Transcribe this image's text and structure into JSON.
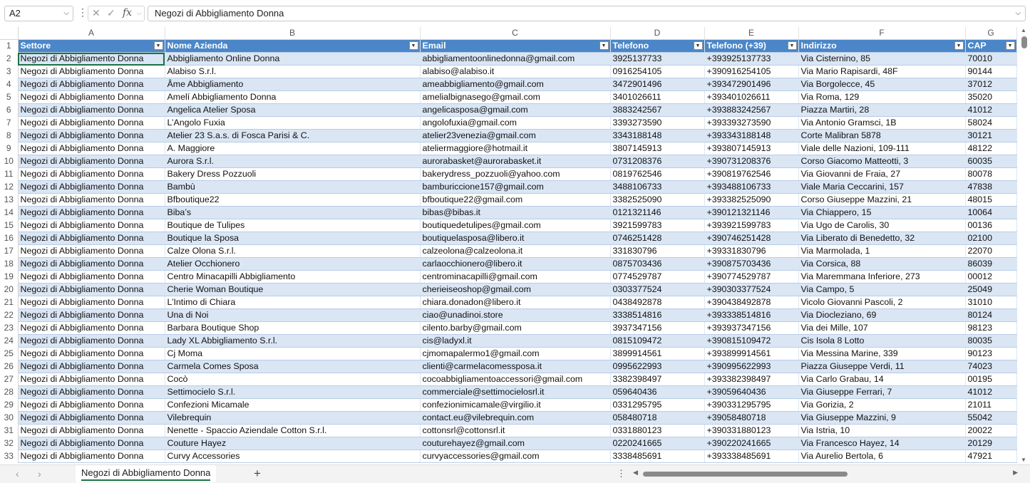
{
  "formula_bar": {
    "name_box": "A2",
    "formula": "Negozi di Abbigliamento Donna"
  },
  "column_letters": [
    "A",
    "B",
    "C",
    "D",
    "E",
    "F",
    "G"
  ],
  "headers": [
    "Settore",
    "Nome Azienda",
    "Email",
    "Telefono",
    "Telefono (+39)",
    "Indirizzo",
    "CAP"
  ],
  "rows": [
    [
      "Negozi di Abbigliamento Donna",
      "Abbigliamento Online Donna",
      "abbigliamentoonlinedonna@gmail.com",
      "3925137733",
      "+393925137733",
      "Via Cisternino, 85",
      "70010"
    ],
    [
      "Negozi di Abbigliamento Donna",
      "Alabiso S.r.l.",
      "alabiso@alabiso.it",
      "0916254105",
      "+390916254105",
      "Via Mario Rapisardi, 48F",
      "90144"
    ],
    [
      "Negozi di Abbigliamento Donna",
      "Âme Abbigliamento",
      "ameabbigliamento@gmail.com",
      "3472901496",
      "+393472901496",
      "Via Borgolecce, 45",
      "37012"
    ],
    [
      "Negozi di Abbigliamento Donna",
      "Amelí Abbigliamento Donna",
      "amelialbignasego@gmail.com",
      "3401026611",
      "+393401026611",
      "Via Roma, 129",
      "35020"
    ],
    [
      "Negozi di Abbigliamento Donna",
      "Angelica Atelier Sposa",
      "angelicasposa@gmail.com",
      "3883242567",
      "+393883242567",
      "Piazza Martiri, 28",
      "41012"
    ],
    [
      "Negozi di Abbigliamento Donna",
      "L’Angolo Fuxia",
      "angolofuxia@gmail.com",
      "3393273590",
      "+393393273590",
      "Via Antonio Gramsci, 1B",
      "58024"
    ],
    [
      "Negozi di Abbigliamento Donna",
      "Atelier 23 S.a.s. di Fosca Parisi & C.",
      "atelier23venezia@gmail.com",
      "3343188148",
      "+393343188148",
      "Corte Malibran 5878",
      "30121"
    ],
    [
      "Negozi di Abbigliamento Donna",
      "A. Maggiore",
      "ateliermaggiore@hotmail.it",
      "3807145913",
      "+393807145913",
      "Viale delle Nazioni, 109-111",
      "48122"
    ],
    [
      "Negozi di Abbigliamento Donna",
      "Aurora S.r.l.",
      "aurorabasket@aurorabasket.it",
      "0731208376",
      "+390731208376",
      "Corso Giacomo Matteotti, 3",
      "60035"
    ],
    [
      "Negozi di Abbigliamento Donna",
      "Bakery Dress Pozzuoli",
      "bakerydress_pozzuoli@yahoo.com",
      "0819762546",
      "+390819762546",
      "Via Giovanni de Fraia, 27",
      "80078"
    ],
    [
      "Negozi di Abbigliamento Donna",
      "Bambù",
      "bamburiccione157@gmail.com",
      "3488106733",
      "+393488106733",
      "Viale Maria Ceccarini, 157",
      "47838"
    ],
    [
      "Negozi di Abbigliamento Donna",
      "Bfboutique22",
      "bfboutique22@gmail.com",
      "3382525090",
      "+393382525090",
      "Corso Giuseppe Mazzini, 21",
      "48015"
    ],
    [
      "Negozi di Abbigliamento Donna",
      "Biba’s",
      "bibas@bibas.it",
      "0121321146",
      "+390121321146",
      "Via Chiappero, 15",
      "10064"
    ],
    [
      "Negozi di Abbigliamento Donna",
      "Boutique de Tulipes",
      "boutiquedetulipes@gmail.com",
      "3921599783",
      "+393921599783",
      "Via Ugo de Carolis, 30",
      "00136"
    ],
    [
      "Negozi di Abbigliamento Donna",
      "Boutique la Sposa",
      "boutiquelasposa@libero.it",
      "0746251428",
      "+390746251428",
      "Via Liberato di Benedetto, 32",
      "02100"
    ],
    [
      "Negozi di Abbigliamento Donna",
      "Calze Olona S.r.l.",
      "calzeolona@calzeolona.it",
      "331830796",
      "+39331830796",
      "Via Marmolada, 1",
      "22070"
    ],
    [
      "Negozi di Abbigliamento Donna",
      "Atelier Occhionero",
      "carlaocchionero@libero.it",
      "0875703436",
      "+390875703436",
      "Via Corsica, 88",
      "86039"
    ],
    [
      "Negozi di Abbigliamento Donna",
      "Centro Minacapilli Abbigliamento",
      "centrominacapilli@gmail.com",
      "0774529787",
      "+390774529787",
      "Via Maremmana Inferiore, 273",
      "00012"
    ],
    [
      "Negozi di Abbigliamento Donna",
      "Cherie Woman Boutique",
      "cherieiseoshop@gmail.com",
      "0303377524",
      "+390303377524",
      "Via Campo, 5",
      "25049"
    ],
    [
      "Negozi di Abbigliamento Donna",
      "L’Intimo di Chiara",
      "chiara.donadon@libero.it",
      "0438492878",
      "+390438492878",
      "Vicolo Giovanni Pascoli, 2",
      "31010"
    ],
    [
      "Negozi di Abbigliamento Donna",
      "Una di Noi",
      "ciao@unadinoi.store",
      "3338514816",
      "+393338514816",
      "Via Diocleziano, 69",
      "80124"
    ],
    [
      "Negozi di Abbigliamento Donna",
      "Barbara Boutique Shop",
      "cilento.barby@gmail.com",
      "3937347156",
      "+393937347156",
      "Via dei Mille, 107",
      "98123"
    ],
    [
      "Negozi di Abbigliamento Donna",
      "Lady XL Abbigliamento S.r.l.",
      "cis@ladyxl.it",
      "0815109472",
      "+390815109472",
      "Cis Isola 8 Lotto",
      "80035"
    ],
    [
      "Negozi di Abbigliamento Donna",
      "Cj Moma",
      "cjmomapalermo1@gmail.com",
      "3899914561",
      "+393899914561",
      "Via Messina Marine, 339",
      "90123"
    ],
    [
      "Negozi di Abbigliamento Donna",
      "Carmela Comes Sposa",
      "clienti@carmelacomessposa.it",
      "0995622993",
      "+390995622993",
      "Piazza Giuseppe Verdi, 11",
      "74023"
    ],
    [
      "Negozi di Abbigliamento Donna",
      "Cocò",
      "cocoabbigliamentoaccessori@gmail.com",
      "3382398497",
      "+393382398497",
      "Via Carlo Grabau, 14",
      "00195"
    ],
    [
      "Negozi di Abbigliamento Donna",
      "Settimocielo S.r.l.",
      "commerciale@settimocielosrl.it",
      "059640436",
      "+39059640436",
      "Via Giuseppe Ferrari, 7",
      "41012"
    ],
    [
      "Negozi di Abbigliamento Donna",
      "Confezioni Micamale",
      "confezionimicamale@virgilio.it",
      "0331295795",
      "+390331295795",
      "Via Gorizia, 2",
      "21011"
    ],
    [
      "Negozi di Abbigliamento Donna",
      "Vilebrequin",
      "contact.eu@vilebrequin.com",
      "058480718",
      "+39058480718",
      "Via Giuseppe Mazzini, 9",
      "55042"
    ],
    [
      "Negozi di Abbigliamento Donna",
      "Nenette - Spaccio Aziendale Cotton S.r.l.",
      "cottonsrl@cottonsrl.it",
      "0331880123",
      "+390331880123",
      "Via Istria, 10",
      "20022"
    ],
    [
      "Negozi di Abbigliamento Donna",
      "Couture Hayez",
      "couturehayez@gmail.com",
      "0220241665",
      "+390220241665",
      "Via Francesco Hayez, 14",
      "20129"
    ],
    [
      "Negozi di Abbigliamento Donna",
      "Curvy Accessories",
      "curvyaccessories@gmail.com",
      "3338485691",
      "+393338485691",
      "Via Aurelio Bertola, 6",
      "47921"
    ]
  ],
  "sheet_tab": "Negozi di Abbigliamento Donna",
  "colors": {
    "header_fill": "#4b86c8",
    "band_fill": "#dae6f4",
    "accent": "#1e7145"
  }
}
